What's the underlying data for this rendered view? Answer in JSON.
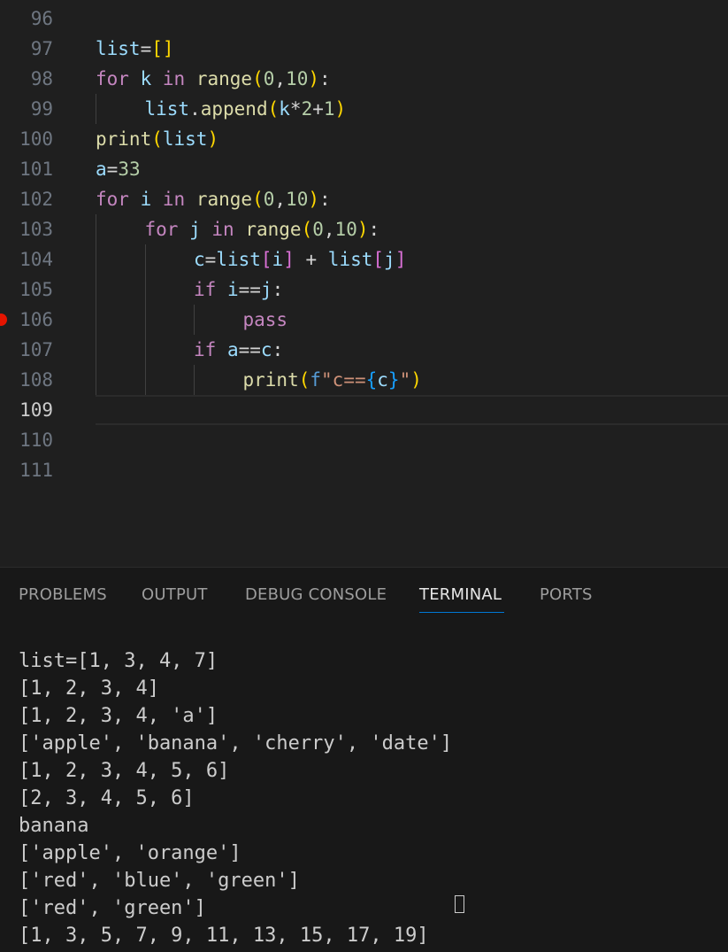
{
  "editor": {
    "lines": [
      {
        "num": "96",
        "indent": 0,
        "tokens": []
      },
      {
        "num": "97",
        "indent": 0,
        "tokens": [
          {
            "t": "list",
            "c": "var"
          },
          {
            "t": "=",
            "c": "op"
          },
          {
            "t": "[]",
            "c": "b1"
          }
        ]
      },
      {
        "num": "98",
        "indent": 0,
        "tokens": [
          {
            "t": "for",
            "c": "kw"
          },
          {
            "t": " ",
            "c": "op"
          },
          {
            "t": "k",
            "c": "var"
          },
          {
            "t": " ",
            "c": "op"
          },
          {
            "t": "in",
            "c": "kw"
          },
          {
            "t": " ",
            "c": "op"
          },
          {
            "t": "range",
            "c": "fn"
          },
          {
            "t": "(",
            "c": "b1"
          },
          {
            "t": "0",
            "c": "num"
          },
          {
            "t": ",",
            "c": "op"
          },
          {
            "t": "10",
            "c": "num"
          },
          {
            "t": ")",
            "c": "b1"
          },
          {
            "t": ":",
            "c": "op"
          }
        ]
      },
      {
        "num": "99",
        "indent": 1,
        "tokens": [
          {
            "t": "list",
            "c": "var"
          },
          {
            "t": ".",
            "c": "op"
          },
          {
            "t": "append",
            "c": "fn"
          },
          {
            "t": "(",
            "c": "b1"
          },
          {
            "t": "k",
            "c": "var"
          },
          {
            "t": "*",
            "c": "op"
          },
          {
            "t": "2",
            "c": "num"
          },
          {
            "t": "+",
            "c": "op"
          },
          {
            "t": "1",
            "c": "num"
          },
          {
            "t": ")",
            "c": "b1"
          }
        ]
      },
      {
        "num": "100",
        "indent": 0,
        "tokens": [
          {
            "t": "print",
            "c": "fn"
          },
          {
            "t": "(",
            "c": "b1"
          },
          {
            "t": "list",
            "c": "var"
          },
          {
            "t": ")",
            "c": "b1"
          }
        ]
      },
      {
        "num": "101",
        "indent": 0,
        "tokens": [
          {
            "t": "a",
            "c": "var"
          },
          {
            "t": "=",
            "c": "op"
          },
          {
            "t": "33",
            "c": "num"
          }
        ]
      },
      {
        "num": "102",
        "indent": 0,
        "tokens": [
          {
            "t": "for",
            "c": "kw"
          },
          {
            "t": " ",
            "c": "op"
          },
          {
            "t": "i",
            "c": "var"
          },
          {
            "t": " ",
            "c": "op"
          },
          {
            "t": "in",
            "c": "kw"
          },
          {
            "t": " ",
            "c": "op"
          },
          {
            "t": "range",
            "c": "fn"
          },
          {
            "t": "(",
            "c": "b1"
          },
          {
            "t": "0",
            "c": "num"
          },
          {
            "t": ",",
            "c": "op"
          },
          {
            "t": "10",
            "c": "num"
          },
          {
            "t": ")",
            "c": "b1"
          },
          {
            "t": ":",
            "c": "op"
          }
        ]
      },
      {
        "num": "103",
        "indent": 1,
        "tokens": [
          {
            "t": "for",
            "c": "kw"
          },
          {
            "t": " ",
            "c": "op"
          },
          {
            "t": "j",
            "c": "var"
          },
          {
            "t": " ",
            "c": "op"
          },
          {
            "t": "in",
            "c": "kw"
          },
          {
            "t": " ",
            "c": "op"
          },
          {
            "t": "range",
            "c": "fn"
          },
          {
            "t": "(",
            "c": "b1"
          },
          {
            "t": "0",
            "c": "num"
          },
          {
            "t": ",",
            "c": "op"
          },
          {
            "t": "10",
            "c": "num"
          },
          {
            "t": ")",
            "c": "b1"
          },
          {
            "t": ":",
            "c": "op"
          }
        ]
      },
      {
        "num": "104",
        "indent": 2,
        "tokens": [
          {
            "t": "c",
            "c": "var"
          },
          {
            "t": "=",
            "c": "op"
          },
          {
            "t": "list",
            "c": "var"
          },
          {
            "t": "[",
            "c": "b2"
          },
          {
            "t": "i",
            "c": "var"
          },
          {
            "t": "]",
            "c": "b2"
          },
          {
            "t": " + ",
            "c": "op"
          },
          {
            "t": "list",
            "c": "var"
          },
          {
            "t": "[",
            "c": "b2"
          },
          {
            "t": "j",
            "c": "var"
          },
          {
            "t": "]",
            "c": "b2"
          }
        ]
      },
      {
        "num": "105",
        "indent": 2,
        "tokens": [
          {
            "t": "if",
            "c": "kw"
          },
          {
            "t": " ",
            "c": "op"
          },
          {
            "t": "i",
            "c": "var"
          },
          {
            "t": "==",
            "c": "op"
          },
          {
            "t": "j",
            "c": "var"
          },
          {
            "t": ":",
            "c": "op"
          }
        ]
      },
      {
        "num": "106",
        "indent": 3,
        "breakpoint": true,
        "tokens": [
          {
            "t": "pass",
            "c": "kw"
          }
        ]
      },
      {
        "num": "107",
        "indent": 2,
        "tokens": [
          {
            "t": "if",
            "c": "kw"
          },
          {
            "t": " ",
            "c": "op"
          },
          {
            "t": "a",
            "c": "var"
          },
          {
            "t": "==",
            "c": "op"
          },
          {
            "t": "c",
            "c": "var"
          },
          {
            "t": ":",
            "c": "op"
          }
        ]
      },
      {
        "num": "108",
        "indent": 3,
        "tokens": [
          {
            "t": "print",
            "c": "fn"
          },
          {
            "t": "(",
            "c": "b1"
          },
          {
            "t": "f",
            "c": "pre"
          },
          {
            "t": "\"c==",
            "c": "str"
          },
          {
            "t": "{",
            "c": "b3"
          },
          {
            "t": "c",
            "c": "var"
          },
          {
            "t": "}",
            "c": "b3"
          },
          {
            "t": "\"",
            "c": "str"
          },
          {
            "t": ")",
            "c": "b1"
          }
        ]
      },
      {
        "num": "109",
        "indent": 0,
        "current": true,
        "tokens": []
      },
      {
        "num": "110",
        "indent": 0,
        "tokens": []
      },
      {
        "num": "111",
        "indent": 0,
        "tokens": []
      }
    ],
    "colors": {
      "kw": "#c586c0",
      "fn": "#dcdcaa",
      "var": "#9cdcfe",
      "num": "#b5cea8",
      "op": "#d4d4d4",
      "str": "#ce9178",
      "b1": "#ffd700",
      "b2": "#da70d6",
      "b3": "#179fff",
      "pre": "#569cd6",
      "breakpoint": "#e51400"
    }
  },
  "panel": {
    "tabs": [
      {
        "label": "PROBLEMS",
        "active": false
      },
      {
        "label": "OUTPUT",
        "active": false
      },
      {
        "label": "DEBUG CONSOLE",
        "active": false
      },
      {
        "label": "TERMINAL",
        "active": true
      },
      {
        "label": "PORTS",
        "active": false
      }
    ],
    "accent": "#0078d4",
    "terminal_lines": [
      "list=[1, 3, 4, 7]",
      "[1, 2, 3, 4]",
      "[1, 2, 3, 4, 'a']",
      "['apple', 'banana', 'cherry', 'date']",
      "[1, 2, 3, 4, 5, 6]",
      "[2, 3, 4, 5, 6]",
      "banana",
      "['apple', 'orange']",
      "['red', 'blue', 'green']",
      "['red', 'green']",
      "[1, 3, 5, 7, 9, 11, 13, 15, 17, 19]"
    ]
  }
}
